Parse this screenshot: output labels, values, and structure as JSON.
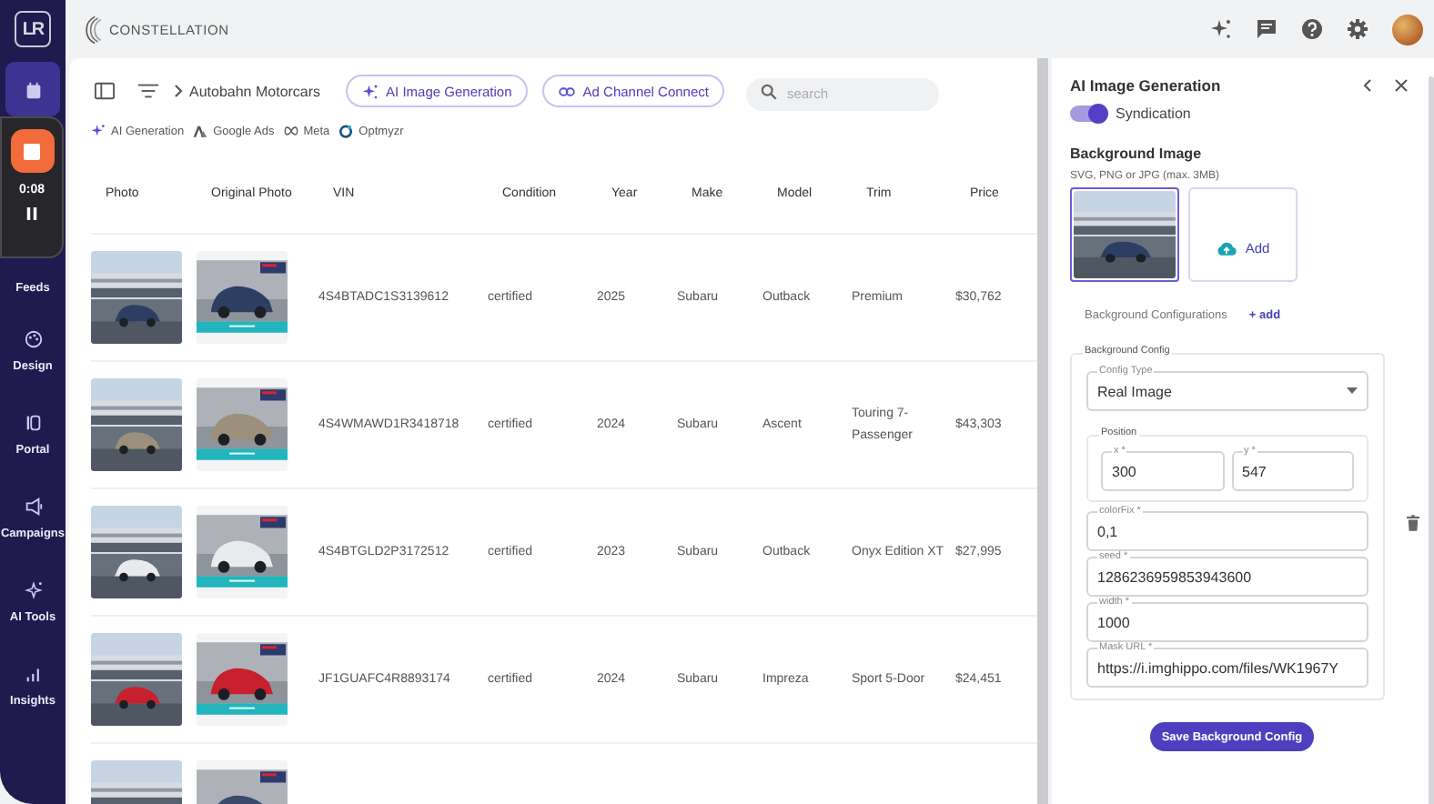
{
  "app": {
    "logo": "LR",
    "brand": "CONSTELLATION"
  },
  "recorder": {
    "time": "0:08"
  },
  "sidebar": {
    "items": [
      {
        "selected": true
      },
      {
        "label": "Feeds",
        "selected": false
      },
      {
        "label": "Design",
        "selected": false
      },
      {
        "label": "Portal",
        "selected": false
      },
      {
        "label": "Campaigns",
        "selected": false
      },
      {
        "label": "AI Tools",
        "selected": false
      },
      {
        "label": "Insights",
        "selected": false
      }
    ]
  },
  "toolbar": {
    "breadcrumb": "Autobahn Motorcars",
    "buttons": [
      "AI Image Generation",
      "Ad Channel Connect"
    ],
    "search": {
      "placeholder": "search"
    },
    "chips": [
      "AI Generation",
      "Google Ads",
      "Meta",
      "Optmyzr"
    ]
  },
  "table": {
    "columns": [
      "Photo",
      "Original Photo",
      "VIN",
      "Condition",
      "Year",
      "Make",
      "Model",
      "Trim",
      "Price"
    ],
    "rows": [
      {
        "vin": "4S4BTADC1S3139612",
        "condition": "certified",
        "year": "2025",
        "make": "Subaru",
        "model": "Outback",
        "trim": "Premium",
        "price": "$30,762"
      },
      {
        "vin": "4S4WMAWD1R3418718",
        "condition": "certified",
        "year": "2024",
        "make": "Subaru",
        "model": "Ascent",
        "trim": "Touring 7-Passenger",
        "price": "$43,303"
      },
      {
        "vin": "4S4BTGLD2P3172512",
        "condition": "certified",
        "year": "2023",
        "make": "Subaru",
        "model": "Outback",
        "trim": "Onyx Edition XT",
        "price": "$27,995"
      },
      {
        "vin": "JF1GUAFC4R8893174",
        "condition": "certified",
        "year": "2024",
        "make": "Subaru",
        "model": "Impreza",
        "trim": "Sport 5-Door",
        "price": "$24,451"
      },
      {}
    ]
  },
  "panel": {
    "title": "AI Image Generation",
    "toggle": {
      "label": "Syndication",
      "on": true
    },
    "section": "Background Image",
    "hint": "SVG, PNG or JPG (max. 3MB)",
    "images": [
      {
        "kind": "picture",
        "selected": true
      }
    ],
    "add_label": "Add",
    "configurations": "Background Configurations",
    "add_link": "+ add",
    "config": {
      "legend": "Background Config",
      "config_type": {
        "label": "Config Type",
        "value": "Real Image"
      },
      "position": {
        "legend": "Position",
        "fields": [
          {
            "label": "x *",
            "value": "300"
          },
          {
            "label": "y *",
            "value": "547"
          }
        ]
      },
      "fields": [
        {
          "label": "colorFix *",
          "value": "0,1"
        },
        {
          "label": "seed *",
          "value": "1286236959853943600"
        },
        {
          "label": "width *",
          "value": "1000"
        },
        {
          "label": "Mask URL *",
          "value": "https://i.imghippo.com/files/WK1967Y"
        }
      ]
    },
    "save_button": "Save Background Config"
  }
}
